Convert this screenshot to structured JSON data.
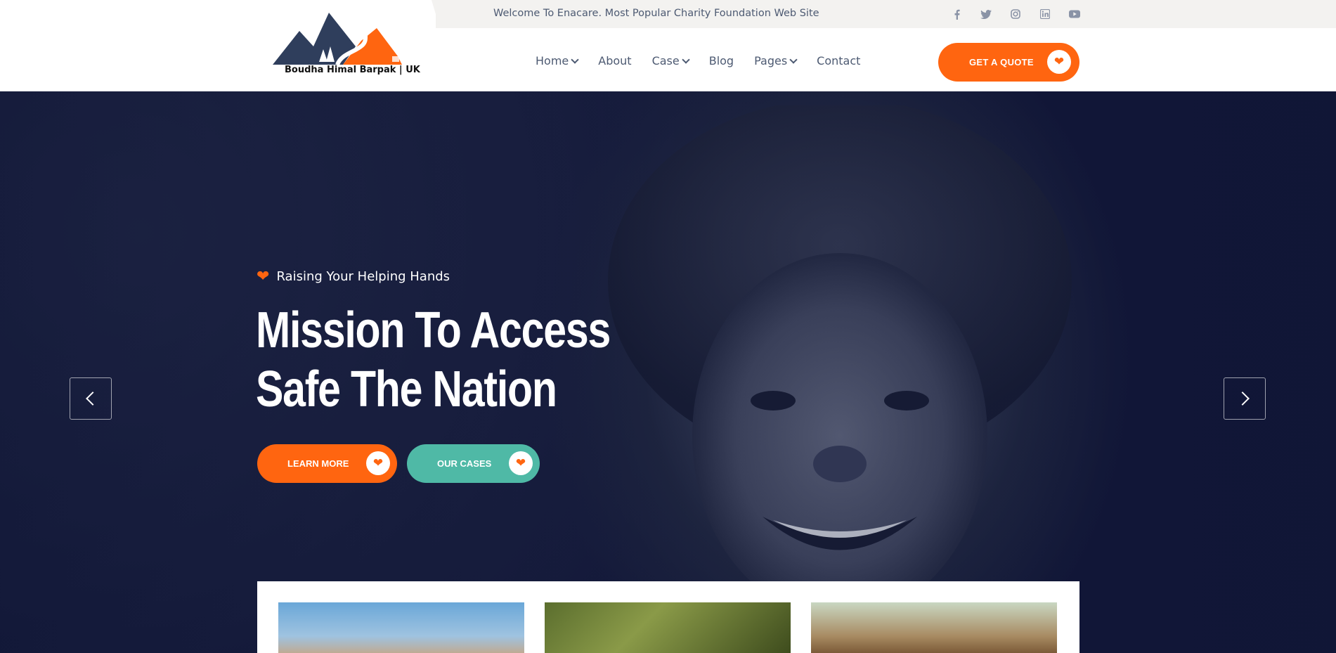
{
  "topbar": {
    "welcome": "Welcome To Enacare. Most Popular Charity Foundation Web Site",
    "socials": [
      "facebook-icon",
      "twitter-icon",
      "instagram-icon",
      "linkedin-icon",
      "youtube-icon"
    ]
  },
  "header": {
    "logo_text": "Boudha Himal Barpak | UK",
    "nav": [
      {
        "label": "Home",
        "dropdown": true
      },
      {
        "label": "About",
        "dropdown": false
      },
      {
        "label": "Case",
        "dropdown": true
      },
      {
        "label": "Blog",
        "dropdown": false
      },
      {
        "label": "Pages",
        "dropdown": true
      },
      {
        "label": "Contact",
        "dropdown": false
      }
    ],
    "quote_label": "GET A QUOTE"
  },
  "hero": {
    "tagline": "Raising Your Helping Hands",
    "title_line1": "Mission To Access",
    "title_line2": "Safe The Nation",
    "learn_more_label": "LEARN MORE",
    "our_cases_label": "OUR CASES"
  },
  "colors": {
    "accent": "#ff6510",
    "teal": "#4fb9a6",
    "hero_dark": "#14193a",
    "text_muted": "#4d5a72"
  }
}
